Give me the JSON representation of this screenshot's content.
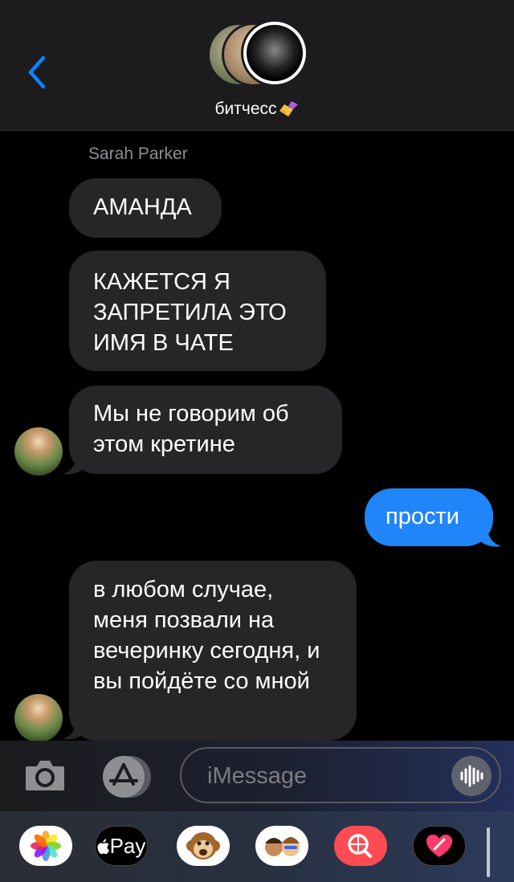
{
  "header": {
    "back_icon": "chevron-left-icon",
    "group_name": "битчесс"
  },
  "thread": {
    "sender_name": "Sarah Parker",
    "messages": [
      {
        "direction": "in",
        "text": "АМАНДА"
      },
      {
        "direction": "in",
        "text": "КАЖЕТСЯ Я ЗАПРЕТИЛА ЭТО ИМЯ В ЧАТЕ"
      },
      {
        "direction": "in",
        "text": "Мы не говорим об этом кретине"
      },
      {
        "direction": "out",
        "text": "прости"
      },
      {
        "direction": "in",
        "text": "в любом случае, меня позвали на вечеринку сегодня, и вы пойдёте со мной"
      }
    ]
  },
  "input": {
    "placeholder": "iMessage",
    "camera_icon": "camera-icon",
    "appstore_icon": "app-store-icon",
    "audio_icon": "waveform-icon"
  },
  "drawer": {
    "apps": [
      {
        "name": "photos-app-icon"
      },
      {
        "name": "apple-pay-app",
        "label": "Pay"
      },
      {
        "name": "animoji-app-icon"
      },
      {
        "name": "memoji-app-icon"
      },
      {
        "name": "image-search-app-icon"
      },
      {
        "name": "digital-touch-app-icon"
      }
    ]
  },
  "colors": {
    "incoming_bubble": "#262628",
    "outgoing_bubble": "#1f85f8",
    "accent": "#0a84ff"
  }
}
